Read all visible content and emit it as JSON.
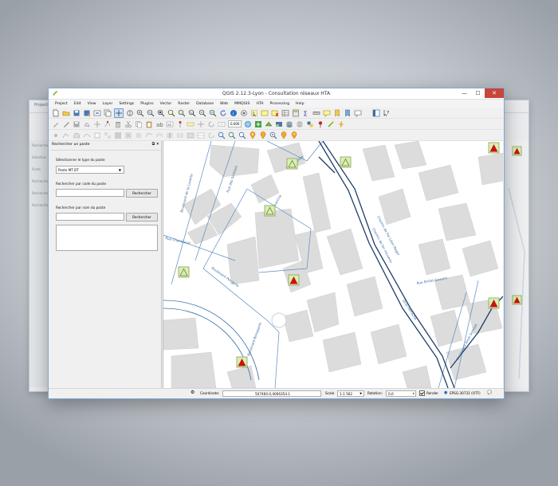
{
  "window": {
    "title": "QGIS 2.12.3-Lyon - Consultation réseaux HTA",
    "controls": {
      "minimize": "—",
      "maximize": "☐",
      "close": "✕"
    }
  },
  "menus": [
    "Project",
    "Edit",
    "View",
    "Layer",
    "Settings",
    "Plugins",
    "Vector",
    "Raster",
    "Database",
    "Web",
    "MMQGIS",
    "HTA",
    "Processing",
    "Help"
  ],
  "toolbar": {
    "scale_value": "0,000"
  },
  "dock": {
    "title": "Rechercher un poste",
    "type_label": "Sélectionner le type du poste",
    "type_value": "Poste MT BT",
    "code_label": "Rechercher par code du poste",
    "code_button": "Rechercher",
    "name_label": "Rechercher par nom du poste",
    "name_button": "Rechercher"
  },
  "map": {
    "street_labels": [
      "Boulevard de la Lunette",
      "Rue des Sorbiers",
      "Rue Lamartine",
      "Rue Ampère",
      "Rue Chambaud",
      "Boulevard Perrache",
      "Boulevard Bonaparte",
      "Chemin de Fer Léon Roger",
      "Chemin de fer nouveau",
      "Rue Brillat-Savarin",
      "Quai Perrache",
      "Boulevard Aimé Sembat"
    ],
    "colors": {
      "road": "#3a6ea5",
      "network": "#1f3d6b",
      "building": "#dcdcdc",
      "symbol_fill": "#d8f0b0",
      "symbol_border": "#8aa060",
      "alert": "#cc1111"
    }
  },
  "status": {
    "coordinate_label": "Coordinate:",
    "coordinate_value": "507460.0,4066354.1",
    "scale_label": "Scale",
    "scale_value": "1:1 562",
    "rotation_label": "Rotation:",
    "rotation_value": "0,0",
    "render_label": "Render",
    "crs_label": "EPSG:30731 (OTF)"
  },
  "ghost": {
    "labels": [
      "Project",
      "Rechercher",
      "Sélection",
      "Poste",
      "Rechercher",
      "Rechercher",
      "Rechercher"
    ]
  }
}
